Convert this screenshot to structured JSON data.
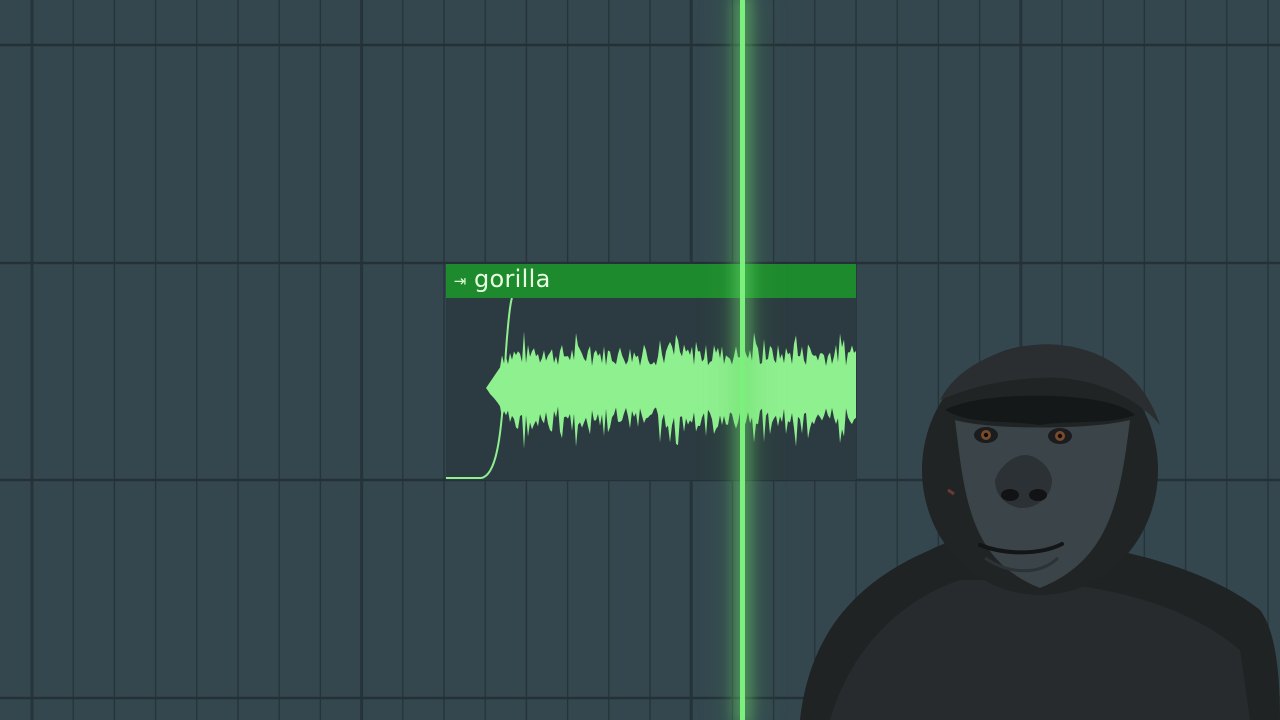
{
  "clip": {
    "name": "gorilla",
    "icon": "audio-clip-icon",
    "header_color": "#1e8a2e",
    "wave_color": "#8ff08f"
  },
  "playhead": {
    "color": "#7cf07c"
  },
  "background": {
    "color": "#34474f",
    "grid_line_color": "#263439"
  },
  "overlay_image": {
    "subject": "gorilla"
  }
}
